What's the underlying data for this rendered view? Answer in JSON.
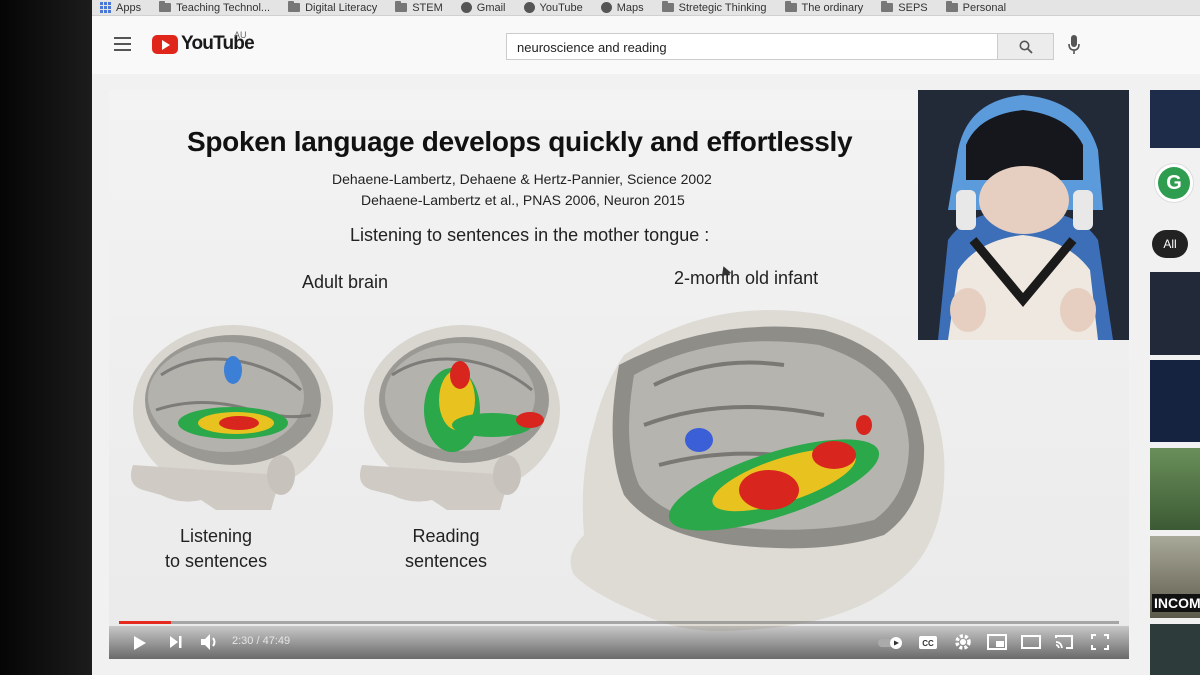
{
  "bookmarks": [
    {
      "label": "Apps",
      "icon": "apps-grid-icon"
    },
    {
      "label": "Teaching Technol...",
      "icon": "folder-icon"
    },
    {
      "label": "Digital Literacy",
      "icon": "folder-icon"
    },
    {
      "label": "STEM",
      "icon": "folder-icon"
    },
    {
      "label": "Gmail",
      "icon": "globe-icon"
    },
    {
      "label": "YouTube",
      "icon": "globe-icon"
    },
    {
      "label": "Maps",
      "icon": "globe-icon"
    },
    {
      "label": "Stretegic Thinking",
      "icon": "folder-icon"
    },
    {
      "label": "The ordinary",
      "icon": "folder-icon"
    },
    {
      "label": "SEPS",
      "icon": "folder-icon"
    },
    {
      "label": "Personal",
      "icon": "folder-icon"
    }
  ],
  "header": {
    "logo_text": "YouTube",
    "region": "AU",
    "search_value": "neuroscience and reading"
  },
  "slide": {
    "title": "Spoken language develops quickly and effortlessly",
    "citation_1": "Dehaene-Lambertz, Dehaene & Hertz-Pannier, Science 2002",
    "citation_2": "Dehaene-Lambertz et al., PNAS 2006, Neuron 2015",
    "subtitle": "Listening to sentences in the mother tongue :",
    "adult_label": "Adult brain",
    "infant_label": "2-month old infant",
    "listening_line1": "Listening",
    "listening_line2": "to sentences",
    "reading_line1": "Reading",
    "reading_line2": "sentences"
  },
  "player": {
    "time": "2:30 / 47:49",
    "progress_fraction": 0.052
  },
  "sidebar": {
    "avatar_letter": "G",
    "chip_all": "All",
    "thumb_text": "INCOM"
  },
  "colors": {
    "youtube_red": "#e0261b",
    "progress_red": "#e52b1f",
    "grammarly_green": "#2e9d4f"
  }
}
